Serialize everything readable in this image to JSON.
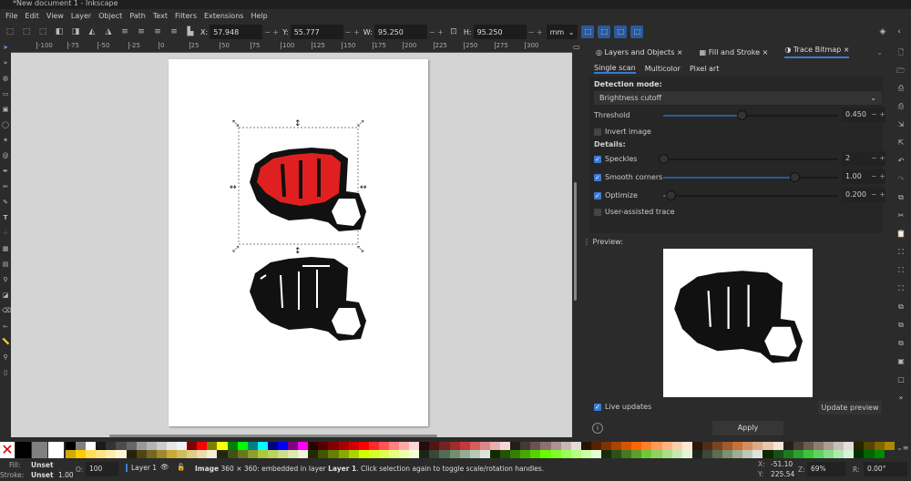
{
  "title": "*New document 1 - Inkscape",
  "menu": [
    "File",
    "Edit",
    "View",
    "Layer",
    "Object",
    "Path",
    "Text",
    "Filters",
    "Extensions",
    "Help"
  ],
  "toolbar": {
    "x_label": "X:",
    "x": "57.948",
    "y_label": "Y:",
    "y": "55.777",
    "w_label": "W:",
    "w": "95.250",
    "h_label": "H:",
    "h": "95.250",
    "unit": "mm"
  },
  "ruler": [
    "-100",
    "-75",
    "-50",
    "-25",
    "0",
    "25",
    "50",
    "75",
    "100",
    "125",
    "150",
    "175",
    "200",
    "225",
    "250",
    "275",
    "300"
  ],
  "tabs": [
    {
      "label": "Layers and Objects"
    },
    {
      "label": "Fill and Stroke"
    },
    {
      "label": "Trace Bitmap"
    }
  ],
  "subtabs": [
    "Single scan",
    "Multicolor",
    "Pixel art"
  ],
  "trace": {
    "detection_mode_label": "Detection mode:",
    "detection_mode": "Brightness cutoff",
    "threshold_label": "Threshold",
    "threshold": "0.450",
    "threshold_fraction": 0.45,
    "invert_label": "Invert image",
    "invert": false,
    "details_label": "Details:",
    "speckles_label": "Speckles",
    "speckles": "2",
    "speckles_on": true,
    "speckles_fraction": 0.0,
    "smooth_label": "Smooth corners",
    "smooth": "1.00",
    "smooth_on": true,
    "smooth_fraction": 0.75,
    "optimize_label": "Optimize",
    "optimize": "0.200",
    "optimize_on": true,
    "optimize_fraction": 0.04,
    "user_assisted_label": "User-assisted trace",
    "user_assisted": false,
    "preview_label": "Preview:",
    "live_updates_label": "Live updates",
    "live_updates": true,
    "update_preview": "Update preview",
    "apply": "Apply"
  },
  "palette": [
    "#000000",
    "#808080",
    "#ffffff",
    "#1a1a1a",
    "#333333",
    "#4d4d4d",
    "#666666",
    "#999999",
    "#b3b3b3",
    "#cccccc",
    "#e6e6e6",
    "#f2f2f2",
    "#800000",
    "#ff0000",
    "#808000",
    "#ffff00",
    "#008000",
    "#00ff00",
    "#008080",
    "#00ffff",
    "#000080",
    "#0000ff",
    "#800080",
    "#ff00ff",
    "#2b0000",
    "#550000",
    "#800000",
    "#aa0000",
    "#d40000",
    "#ff0000",
    "#ff2a2a",
    "#ff5555",
    "#ff8080",
    "#ffaaaa",
    "#ffd5d5",
    "#280b0b",
    "#501616",
    "#782121",
    "#a02c2c",
    "#c83737",
    "#d35f5f",
    "#de8787",
    "#e9afaf",
    "#f4d7d7",
    "#241c1c",
    "#483737",
    "#6c5353",
    "#916f6f",
    "#ac9393",
    "#c8b7b7",
    "#e3dbdb",
    "#2b1100",
    "#552200",
    "#803300",
    "#aa4400",
    "#d45500",
    "#ff6600",
    "#ff7f2a",
    "#ff9955",
    "#ffb380",
    "#ffccaa",
    "#ffe6d5",
    "#28170b",
    "#502d16",
    "#784421",
    "#a05a2c",
    "#c87137",
    "#d38d5f",
    "#deaa87",
    "#e9c6af",
    "#f4e3d7",
    "#241f1c",
    "#483e37",
    "#6c5d53",
    "#917c6f",
    "#ac9d93",
    "#c8beb7",
    "#e3dedb",
    "#2b2200",
    "#554400",
    "#806600",
    "#aa8800"
  ],
  "palette2": [
    "#d4aa00",
    "#ffcc00",
    "#ffdd55",
    "#ffe680",
    "#ffeeaa",
    "#fff6d5",
    "#28220b",
    "#504416",
    "#786721",
    "#a0892c",
    "#c8ab37",
    "#d3bc5f",
    "#decd87",
    "#e9ddaf",
    "#f4eed7",
    "#22280b",
    "#445016",
    "#677821",
    "#89a02c",
    "#abc837",
    "#bcd35f",
    "#cdde87",
    "#dde9af",
    "#eef4d7",
    "#222b00",
    "#445500",
    "#668000",
    "#88aa00",
    "#aad400",
    "#ccff00",
    "#d4ff2a",
    "#ddff55",
    "#e5ff80",
    "#eeffaa",
    "#f6ffd5",
    "#1c241c",
    "#374837",
    "#536c53",
    "#6f916f",
    "#93ac93",
    "#b7c8b7",
    "#dbe3db",
    "#112b00",
    "#225500",
    "#338000",
    "#44aa00",
    "#55d400",
    "#66ff00",
    "#7fff2a",
    "#99ff55",
    "#b3ff80",
    "#ccffaa",
    "#e5ffd5",
    "#162d0b",
    "#2c5016",
    "#447821",
    "#5aa02c",
    "#71c837",
    "#8dd35f",
    "#aade87",
    "#c6e9af",
    "#e3f4d7",
    "#1f241c",
    "#3e4837",
    "#5d6c53",
    "#7c916f",
    "#9dac93",
    "#bec8b7",
    "#dee3db",
    "#0b2800",
    "#165016",
    "#217821",
    "#2ca02c",
    "#37c837",
    "#5fd35f",
    "#87de87",
    "#afe9af",
    "#d7f4d7",
    "#003300",
    "#006600",
    "#008800"
  ],
  "status": {
    "fill_label": "Fill:",
    "fill": "Unset",
    "stroke_label": "Stroke:",
    "stroke": "Unset",
    "stroke_width": "1.00",
    "opacity_label": "O:",
    "opacity": "100",
    "layer": "Layer 1",
    "msg_bold": "Image",
    "msg": "360 × 360: embedded in layer",
    "msg_layer": "Layer 1",
    "msg_tail": ". Click selection again to toggle scale/rotation handles.",
    "x_label": "X:",
    "x": "-51.10",
    "y_label": "Y:",
    "y": "225.54",
    "zoom_label": "Z:",
    "zoom": "69%",
    "rot_label": "R:",
    "rot": "0.00°"
  }
}
